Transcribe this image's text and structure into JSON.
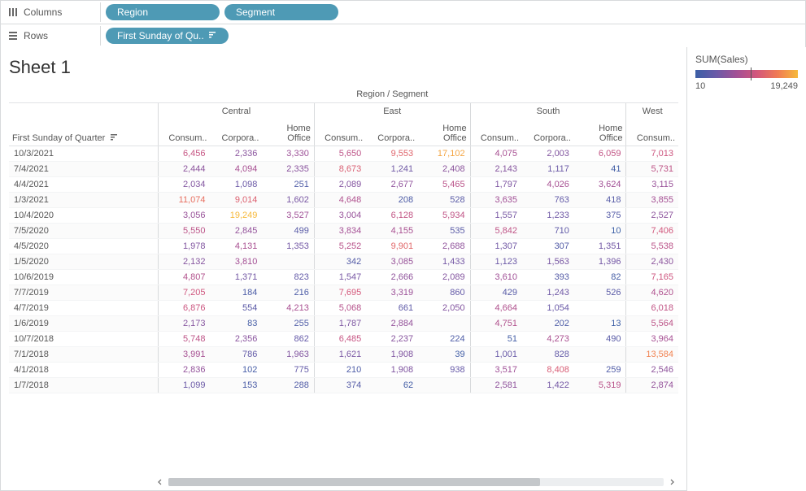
{
  "shelves": {
    "columns_label": "Columns",
    "rows_label": "Rows",
    "col_pills": [
      "Region",
      "Segment"
    ],
    "row_pill": "First Sunday of Qu.."
  },
  "sheet": {
    "title": "Sheet 1",
    "super_header": "Region / Segment",
    "row_header": "First Sunday of Quarter",
    "regions": [
      "Central",
      "East",
      "South",
      "West"
    ],
    "segments_full": [
      "Consum..",
      "Corpora..",
      "Home Office"
    ],
    "segments_west": [
      "Consum.."
    ]
  },
  "legend": {
    "title": "SUM(Sales)",
    "min": "10",
    "max": "19,249"
  },
  "chart_data": {
    "type": "heatmap",
    "row_field": "First Sunday of Quarter",
    "col_fields": [
      "Region",
      "Segment"
    ],
    "measure": "SUM(Sales)",
    "color_scale": {
      "min": 10,
      "max": 19249
    },
    "columns": [
      {
        "region": "Central",
        "segment": "Consumer"
      },
      {
        "region": "Central",
        "segment": "Corporate"
      },
      {
        "region": "Central",
        "segment": "Home Office"
      },
      {
        "region": "East",
        "segment": "Consumer"
      },
      {
        "region": "East",
        "segment": "Corporate"
      },
      {
        "region": "East",
        "segment": "Home Office"
      },
      {
        "region": "South",
        "segment": "Consumer"
      },
      {
        "region": "South",
        "segment": "Corporate"
      },
      {
        "region": "South",
        "segment": "Home Office"
      },
      {
        "region": "West",
        "segment": "Consumer"
      }
    ],
    "rows": [
      {
        "label": "10/3/2021",
        "values": [
          6456,
          2336,
          3330,
          5650,
          9553,
          17102,
          4075,
          2003,
          6059,
          7013
        ]
      },
      {
        "label": "7/4/2021",
        "values": [
          2444,
          4094,
          2335,
          8673,
          1241,
          2408,
          2143,
          1117,
          41,
          5731
        ]
      },
      {
        "label": "4/4/2021",
        "values": [
          2034,
          1098,
          251,
          2089,
          2677,
          5465,
          1797,
          4026,
          3624,
          3115
        ]
      },
      {
        "label": "1/3/2021",
        "values": [
          11074,
          9014,
          1602,
          4648,
          208,
          528,
          3635,
          763,
          418,
          3855
        ]
      },
      {
        "label": "10/4/2020",
        "values": [
          3056,
          19249,
          3527,
          3004,
          6128,
          5934,
          1557,
          1233,
          375,
          2527
        ]
      },
      {
        "label": "7/5/2020",
        "values": [
          5550,
          2845,
          499,
          3834,
          4155,
          535,
          5842,
          710,
          10,
          7406
        ]
      },
      {
        "label": "4/5/2020",
        "values": [
          1978,
          4131,
          1353,
          5252,
          9901,
          2688,
          1307,
          307,
          1351,
          5538
        ]
      },
      {
        "label": "1/5/2020",
        "values": [
          2132,
          3810,
          null,
          342,
          3085,
          1433,
          1123,
          1563,
          1396,
          2430
        ]
      },
      {
        "label": "10/6/2019",
        "values": [
          4807,
          1371,
          823,
          1547,
          2666,
          2089,
          3610,
          393,
          82,
          7165
        ]
      },
      {
        "label": "7/7/2019",
        "values": [
          7205,
          184,
          216,
          7695,
          3319,
          860,
          429,
          1243,
          526,
          4620
        ]
      },
      {
        "label": "4/7/2019",
        "values": [
          6876,
          554,
          4213,
          5068,
          661,
          2050,
          4664,
          1054,
          null,
          6018
        ]
      },
      {
        "label": "1/6/2019",
        "values": [
          2173,
          83,
          255,
          1787,
          2884,
          null,
          4751,
          202,
          13,
          5564
        ]
      },
      {
        "label": "10/7/2018",
        "values": [
          5748,
          2356,
          862,
          6485,
          2237,
          224,
          51,
          4273,
          490,
          3964
        ]
      },
      {
        "label": "7/1/2018",
        "values": [
          3991,
          786,
          1963,
          1621,
          1908,
          39,
          1001,
          828,
          null,
          13584
        ]
      },
      {
        "label": "4/1/2018",
        "values": [
          2836,
          102,
          775,
          210,
          1908,
          938,
          3517,
          8408,
          259,
          2546
        ]
      },
      {
        "label": "1/7/2018",
        "values": [
          1099,
          153,
          288,
          374,
          62,
          null,
          2581,
          1422,
          5319,
          2874
        ]
      }
    ]
  }
}
